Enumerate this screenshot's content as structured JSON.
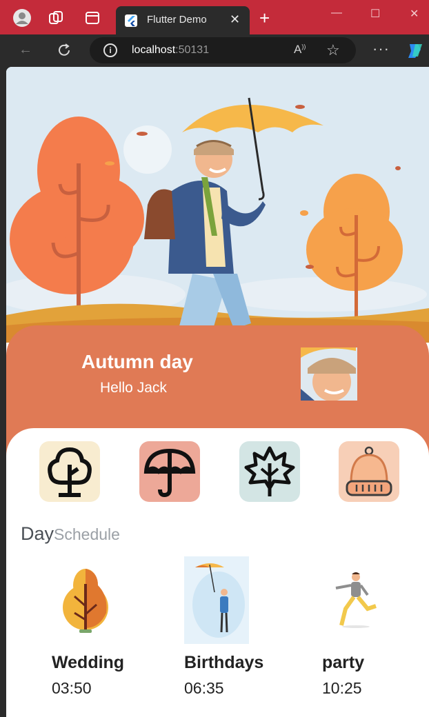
{
  "browser": {
    "tab_title": "Flutter Demo",
    "url_host": "localhost",
    "url_port": ":50131"
  },
  "app": {
    "header_title": "Autumn day",
    "header_subtitle": "Hello Jack",
    "categories": [
      {
        "icon": "tree-icon",
        "bg": "#f8ecd0"
      },
      {
        "icon": "umbrella-icon",
        "bg": "#eda898"
      },
      {
        "icon": "maple-leaf-icon",
        "bg": "#d3e5e4"
      },
      {
        "icon": "beanie-hat-icon",
        "bg": "#f7cfb7"
      }
    ],
    "schedule_title_a": "Day",
    "schedule_title_b": "Schedule",
    "events": [
      {
        "name": "Wedding",
        "time": "03:50"
      },
      {
        "name": "Birthdays",
        "time": "06:35"
      },
      {
        "name": "party",
        "time": "10:25"
      }
    ]
  },
  "colors": {
    "tabbar": "#c42b3a",
    "header_card": "#e07a55",
    "accent_orange": "#f07a4a"
  }
}
